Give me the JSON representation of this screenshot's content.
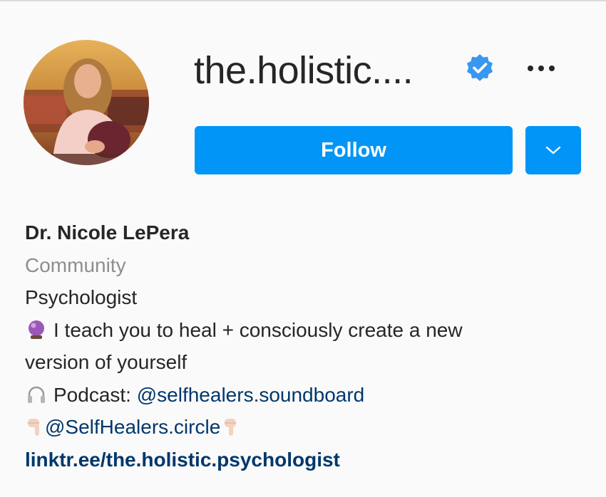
{
  "profile": {
    "username": "the.holistic....",
    "verified": true,
    "avatar_icon": "profile-photo"
  },
  "actions": {
    "follow_label": "Follow",
    "more_icon": "more-options-icon",
    "dropdown_icon": "chevron-down-icon"
  },
  "bio": {
    "name": "Dr. Nicole LePera",
    "category": "Community",
    "line1": "Psychologist",
    "line2": "I teach you to heal + consciously create a new",
    "line3": "version of yourself",
    "podcast_prefix": "Podcast: ",
    "podcast_mention": "@selfhealers.soundboard",
    "circle_mention": "@SelfHealers.circle",
    "link": "linktr.ee/the.holistic.psychologist"
  },
  "colors": {
    "accent": "#0095f6",
    "mention": "#00376b",
    "secondary_text": "#8e8e8e",
    "verified_badge": "#3897f0"
  }
}
